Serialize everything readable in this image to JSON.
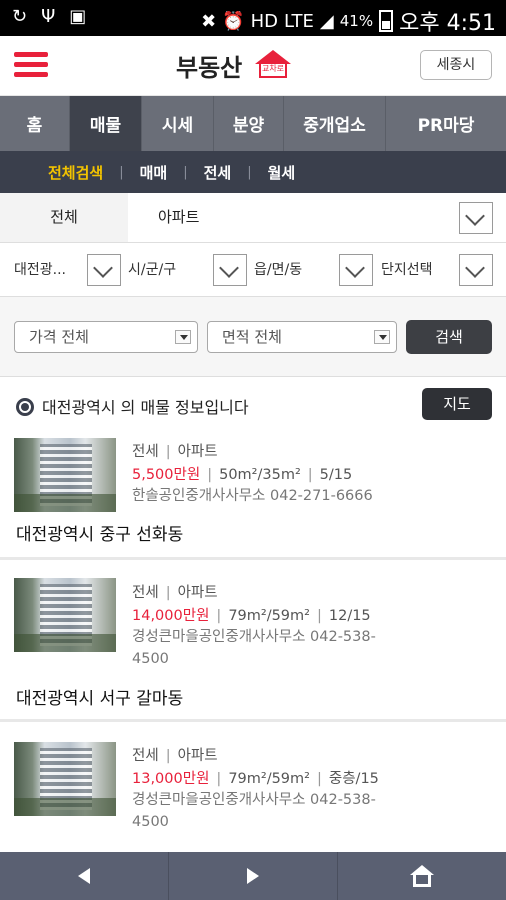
{
  "status": {
    "battery": "41%",
    "network": "LTE",
    "time": "오후 4:51"
  },
  "header": {
    "brand": "부동산",
    "brand_mark": "교차로",
    "region_button": "세종시"
  },
  "main_nav": [
    {
      "label": "홈",
      "active": false
    },
    {
      "label": "매물",
      "active": true
    },
    {
      "label": "시세",
      "active": false
    },
    {
      "label": "분양",
      "active": false
    },
    {
      "label": "중개업소",
      "active": false
    },
    {
      "label": "PR마당",
      "active": false
    }
  ],
  "sub_nav": [
    {
      "label": "전체검색",
      "active": true
    },
    {
      "label": "매매",
      "active": false
    },
    {
      "label": "전세",
      "active": false
    },
    {
      "label": "월세",
      "active": false
    }
  ],
  "type_filter": {
    "all_label": "전체",
    "selected": "아파트"
  },
  "location_filter": {
    "province": "대전광...",
    "city": "시/군/구",
    "town": "읍/면/동",
    "complex": "단지선택"
  },
  "search_filter": {
    "price": "가격 전체",
    "area": "면적 전체",
    "search_button": "검색"
  },
  "info": {
    "text": "대전광역시 의 매물 정보입니다",
    "map_button": "지도"
  },
  "listings": [
    {
      "deal_type": "전세",
      "property_type": "아파트",
      "price": "5,500만원",
      "area": "50m²/35m²",
      "floor": "5/15",
      "agent": "한솔공인중개사사무소 042-271-6666",
      "address": "대전광역시 중구 선화동"
    },
    {
      "deal_type": "전세",
      "property_type": "아파트",
      "price": "14,000만원",
      "area": "79m²/59m²",
      "floor": "12/15",
      "agent": "경성큰마을공인중개사사무소 042-538-4500",
      "address": "대전광역시 서구 갈마동"
    },
    {
      "deal_type": "전세",
      "property_type": "아파트",
      "price": "13,000만원",
      "area": "79m²/59m²",
      "floor": "중층/15",
      "agent": "경성큰마을공인중개사사무소 042-538-4500",
      "address": ""
    }
  ],
  "colors": {
    "accent": "#e8213b",
    "nav_bg": "#6a6e78",
    "nav_active": "#3e424c",
    "sub_nav_bg": "#3a3f4c",
    "sub_nav_active": "#f2c300"
  }
}
